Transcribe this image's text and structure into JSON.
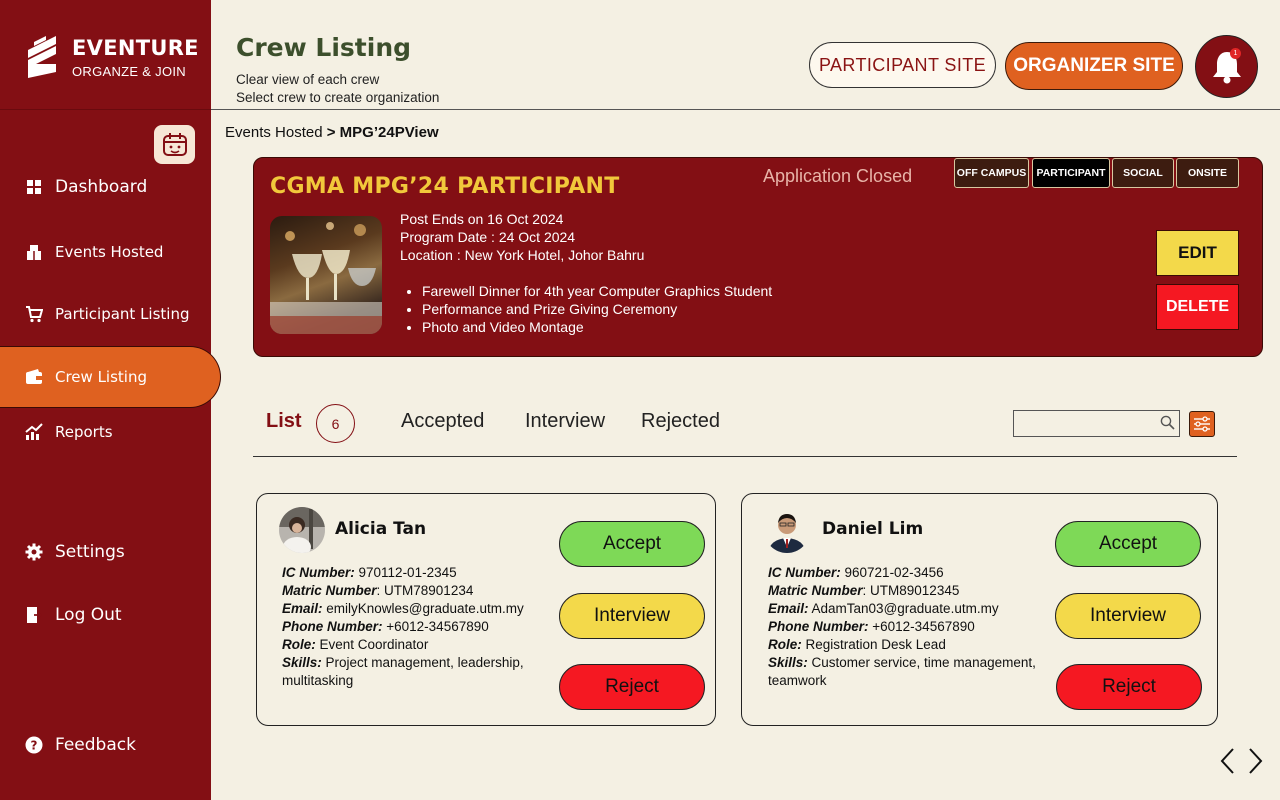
{
  "brand": {
    "name": "EVENTURE",
    "tagline": "ORGANZE & JOIN"
  },
  "sidebar": {
    "items": [
      {
        "label": "Dashboard",
        "icon": "grid-icon"
      },
      {
        "label": "Events Hosted",
        "icon": "boxes-icon"
      },
      {
        "label": "Participant Listing",
        "icon": "cart-icon"
      },
      {
        "label": "Crew Listing",
        "icon": "wallet-icon",
        "active": true
      },
      {
        "label": "Reports",
        "icon": "chart-icon"
      },
      {
        "label": "Settings",
        "icon": "gear-icon"
      },
      {
        "label": "Log Out",
        "icon": "logout-icon"
      },
      {
        "label": "Feedback",
        "icon": "help-icon"
      }
    ]
  },
  "header": {
    "title": "Crew Listing",
    "subtitle_1": "Clear view of each crew",
    "subtitle_2": "Select crew to create organization",
    "participant_site": "PARTICIPANT SITE",
    "organizer_site": "ORGANIZER SITE",
    "notification_count": "1"
  },
  "breadcrumb": {
    "parent": "Events Hosted",
    "sep": " > ",
    "current": "MPG’24PView"
  },
  "event": {
    "title": "CGMA MPG’24 PARTICIPANT",
    "status": "Application Closed",
    "tags": [
      "OFF CAMPUS",
      "PARTICIPANT",
      "SOCIAL",
      "ONSITE"
    ],
    "post_ends": "Post Ends on 16 Oct 2024",
    "program_date": "Program Date : 24 Oct 2024",
    "location": "Location : New York Hotel, Johor Bahru",
    "bullets": [
      "Farewell Dinner for 4th year Computer Graphics Student",
      "Performance and Prize Giving Ceremony",
      "Photo and Video Montage"
    ],
    "edit_label": "EDIT",
    "delete_label": "DELETE"
  },
  "tabs": {
    "list": "List",
    "list_count": "6",
    "accepted": "Accepted",
    "interview": "Interview",
    "rejected": "Rejected",
    "search_placeholder": ""
  },
  "crew": [
    {
      "name": "Alicia Tan",
      "ic_label": "IC Number:",
      "ic": " 970112-01-2345",
      "matric_label": "Matric Number",
      "matric": ": UTM78901234",
      "email_label": "Email:",
      "email": " emilyKnowles@graduate.utm.my",
      "phone_label": "Phone Number:",
      "phone": " +6012-34567890",
      "role_label": "Role:",
      "role": " Event Coordinator",
      "skills_label": "Skills:",
      "skills": " Project management, leadership, multitasking"
    },
    {
      "name": "Daniel Lim",
      "ic_label": "IC Number:",
      "ic": " 960721-02-3456",
      "matric_label": "Matric Number",
      "matric": ": UTM89012345",
      "email_label": "Email:",
      "email": " AdamTan03@graduate.utm.my",
      "phone_label": "Phone Number:",
      "phone": " +6012-34567890",
      "role_label": "Role:",
      "role": " Registration Desk Lead",
      "skills_label": "Skills:",
      "skills": " Customer service, time management, teamwork"
    }
  ],
  "actions": {
    "accept": "Accept",
    "interview": "Interview",
    "reject": "Reject"
  },
  "colors": {
    "sidebar": "#830f14",
    "accent": "#df6120",
    "background": "#f4f0e3",
    "title_gold": "#f1c83b"
  }
}
